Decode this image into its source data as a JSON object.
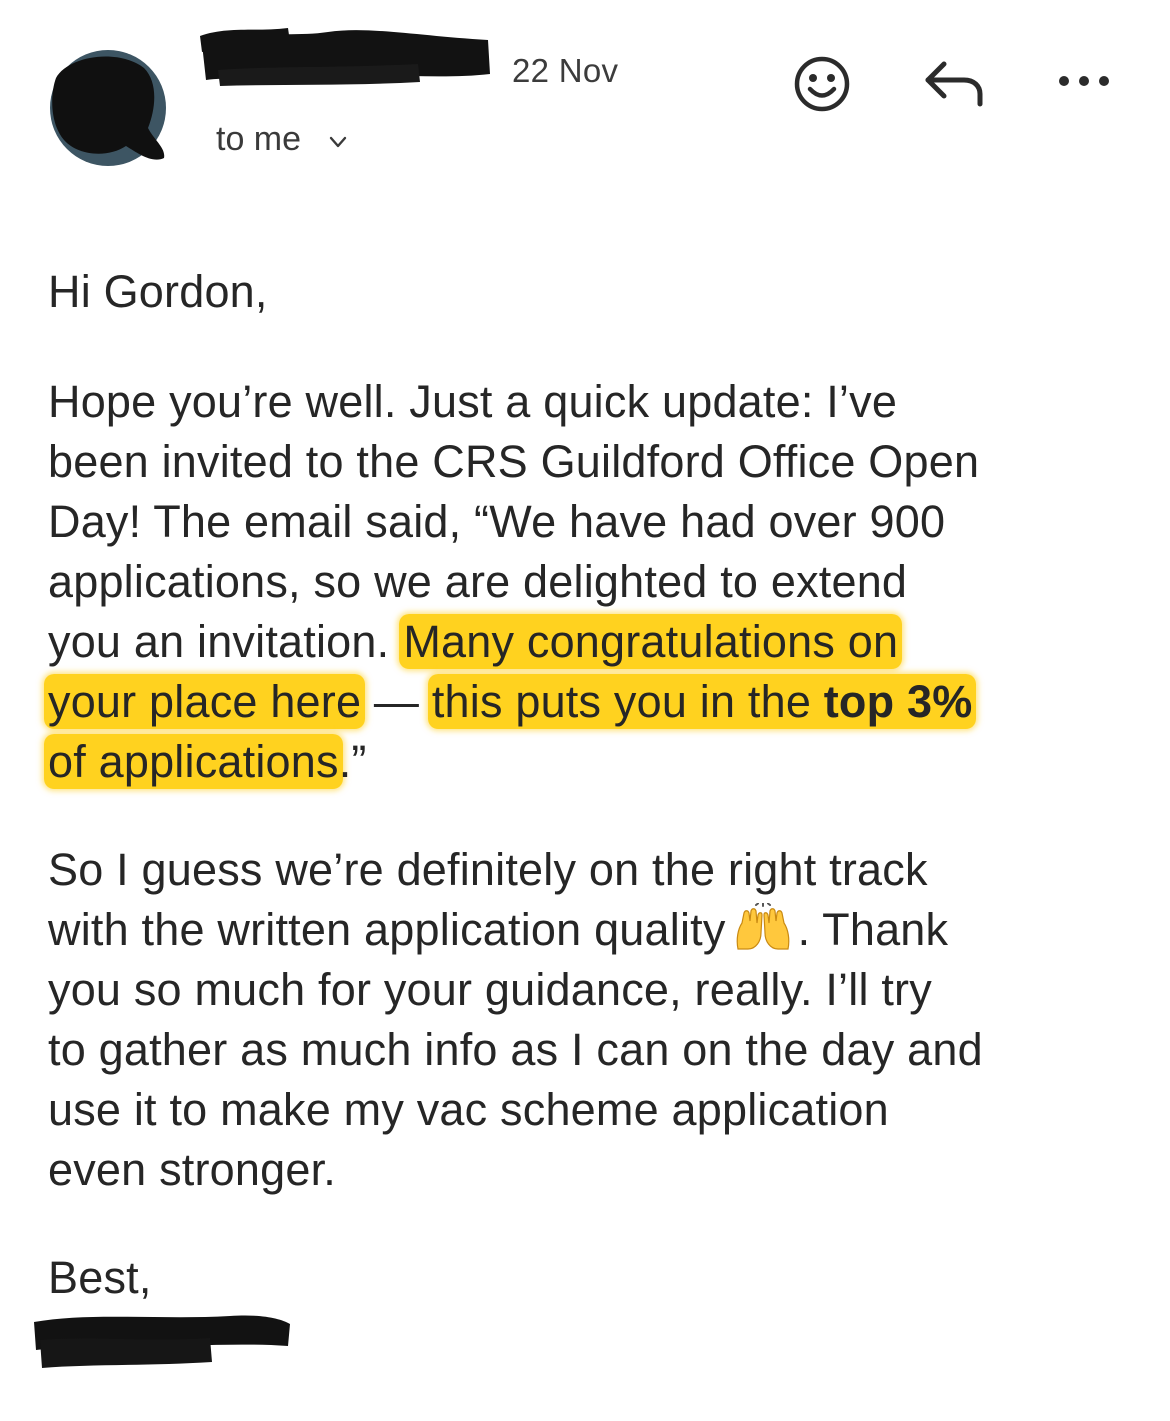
{
  "header": {
    "date": "22 Nov",
    "recipient": "to me",
    "icons": {
      "avatar": "avatar",
      "emoji_react": "smiley-face-icon",
      "reply": "reply-arrow-icon",
      "more": "more-options-icon",
      "recipient_toggle": "chevron-down-icon"
    }
  },
  "email": {
    "greeting": "Hi Gordon,",
    "para1": {
      "line1": "Hope you’re well. Just a quick update: I’ve",
      "line2": "been invited to the CRS Guildford Office Open",
      "line3": "Day! The email said, “We have had over 900",
      "line4": "applications, so we are delighted to extend",
      "line5a": "you an invitation.",
      "line5b": "Many congratulations on",
      "line6a": "your place here",
      "line6b": " — ",
      "line6c": "this puts you in the ",
      "line6d": "top 3%",
      "line7a": "of applications",
      "line7b": ".”"
    },
    "para2": {
      "line1": "So I guess we’re definitely on the right track",
      "line2a": "with the written application quality",
      "emoji_name": "raising-hands-emoji",
      "line2b": ". Thank",
      "line3": "you so much for your guidance, really. I’ll try",
      "line4": "to gather as much info as I can on the day and",
      "line5": "use it to make my vac scheme application",
      "line6": "even stronger."
    },
    "signoff": "Best,"
  },
  "colors": {
    "highlight": "#ffd21f",
    "text": "#262626",
    "redaction": "#111111",
    "avatar": "#3d5563"
  }
}
